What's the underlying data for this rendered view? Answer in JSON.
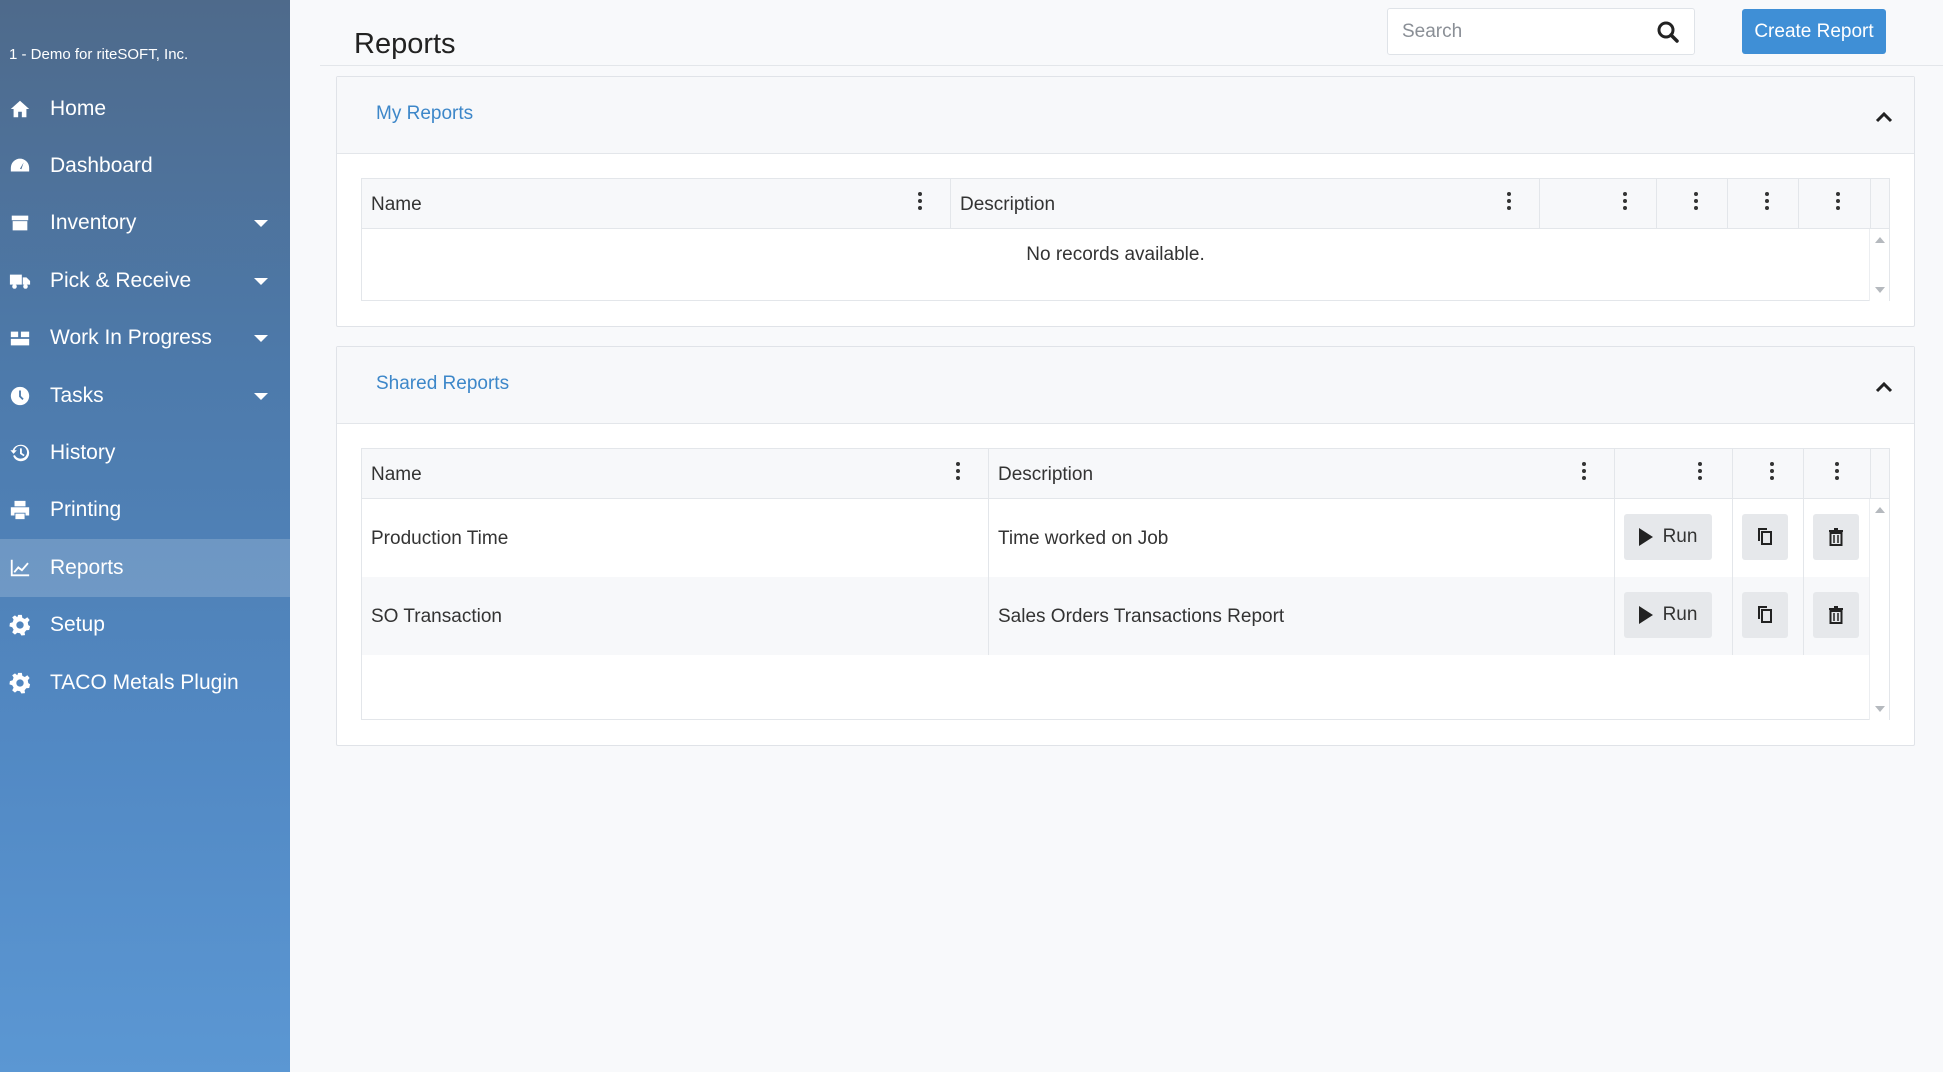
{
  "sidebar": {
    "company": "1 - Demo for riteSOFT, Inc.",
    "items": [
      {
        "label": "Home",
        "icon": "home-icon",
        "caret": false,
        "active": false
      },
      {
        "label": "Dashboard",
        "icon": "dashboard-icon",
        "caret": false,
        "active": false
      },
      {
        "label": "Inventory",
        "icon": "inventory-icon",
        "caret": true,
        "active": false
      },
      {
        "label": "Pick & Receive",
        "icon": "truck-icon",
        "caret": true,
        "active": false
      },
      {
        "label": "Work In Progress",
        "icon": "industry-icon",
        "caret": true,
        "active": false
      },
      {
        "label": "Tasks",
        "icon": "clock-icon",
        "caret": true,
        "active": false
      },
      {
        "label": "History",
        "icon": "history-icon",
        "caret": false,
        "active": false
      },
      {
        "label": "Printing",
        "icon": "printer-icon",
        "caret": false,
        "active": false
      },
      {
        "label": "Reports",
        "icon": "line-chart-icon",
        "caret": false,
        "active": true
      },
      {
        "label": "Setup",
        "icon": "gear-icon",
        "caret": false,
        "active": false
      },
      {
        "label": "TACO Metals Plugin",
        "icon": "gear-icon",
        "caret": false,
        "active": false
      }
    ]
  },
  "header": {
    "title": "Reports",
    "search_placeholder": "Search",
    "create_label": "Create Report"
  },
  "my_reports": {
    "title": "My Reports",
    "columns": {
      "name": "Name",
      "description": "Description"
    },
    "empty_message": "No records available."
  },
  "shared_reports": {
    "title": "Shared Reports",
    "columns": {
      "name": "Name",
      "description": "Description"
    },
    "run_label": "Run",
    "rows": [
      {
        "name": "Production Time",
        "description": "Time worked on Job"
      },
      {
        "name": "SO Transaction",
        "description": "Sales Orders Transactions Report"
      }
    ]
  },
  "colors": {
    "accent": "#3f8fd6",
    "link": "#3d87c9",
    "sidebar_top": "#4e6a8b",
    "sidebar_bottom": "#5b97d3"
  }
}
